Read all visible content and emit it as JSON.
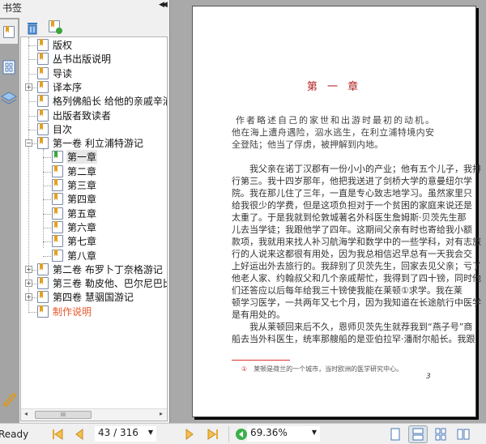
{
  "panel": {
    "title": "书签",
    "collapse_icon": "double-left-arrow"
  },
  "tree": [
    {
      "label": "版权",
      "level": 0
    },
    {
      "label": "丛书出版说明",
      "level": 0
    },
    {
      "label": "导读",
      "level": 0
    },
    {
      "label": "译本序",
      "level": 0,
      "expandable": true
    },
    {
      "label": "格列佛船长 给他的亲戚辛浦",
      "level": 0
    },
    {
      "label": "出版者致读者",
      "level": 0
    },
    {
      "label": "目次",
      "level": 0
    },
    {
      "label": "第一卷  利立浦特游记",
      "level": 0,
      "expanded": true
    },
    {
      "label": "第一章",
      "level": 1,
      "selected": true
    },
    {
      "label": "第二章",
      "level": 1
    },
    {
      "label": "第三章",
      "level": 1
    },
    {
      "label": "第四章",
      "level": 1
    },
    {
      "label": "第五章",
      "level": 1
    },
    {
      "label": "第六章",
      "level": 1
    },
    {
      "label": "第七章",
      "level": 1
    },
    {
      "label": "第八章",
      "level": 1
    },
    {
      "label": "第二卷  布罗卜丁奈格游记",
      "level": 0,
      "expandable": true
    },
    {
      "label": "第三卷  勒皮他、巴尔尼巴比",
      "level": 0,
      "expandable": true
    },
    {
      "label": "第四卷  慧骃国游记",
      "level": 0,
      "expandable": true
    },
    {
      "label": "制作说明",
      "level": 0,
      "color": "#e8572a"
    }
  ],
  "document": {
    "chapter_title": "第  一  章",
    "summary": [
      "作者略述自己的家世和出游时最初的动机。",
      "他在海上遭舟遇险，泅水逃生，在利立浦特境内安",
      "全登陆；他当了俘虏，被押解到内地。"
    ],
    "body": [
      "我父亲在诺丁汉郡有一份小小的产业；他有五个儿子，我排",
      "行第三。我十四岁那年，他把我送进了剑桥大学的意曼纽尔学",
      "院。我在那儿住了三年，一直是专心致志地学习。虽然家里只",
      "给我很少的学费，但是这项负担对于一个贫困的家庭来说还是",
      "太重了。于是我就到伦敦城著名外科医生詹姆斯·贝茨先生那",
      "儿去当学徒；我跟他学了四年。这期间父亲有时也寄给我小额",
      "款项，我就用来找人补习航海学和数学中的一些学科，对有志旅",
      "行的人说来这都很有用处，因为我总相信迟早总有一天我会交",
      "上好运出外去旅行的。我辞别了贝茨先生，回家去见父亲；亏了",
      "他老人家、约翰叔父和几个亲戚帮忙，我得到了四十镑，同时他",
      "们还答应以后每年给我三十镑使我能在莱顿①求学。我在莱",
      "顿学习医学，一共两年又七个月，因为我知道在长途航行中医学",
      "是有用处的。",
      "我从莱顿回来后不久，恩师贝茨先生就荐我到“燕子号”商",
      "船去当外科医生，统率那艘船的是亚伯拉罕·潘耐尔船长。我跟"
    ],
    "footnote_mark": "①",
    "footnote": "莱顿是荷兰的一个城市，当时欧洲的医学研究中心。",
    "page_number": "3"
  },
  "status": {
    "ready": "Ready",
    "page_field": "43 / 316",
    "zoom_field": "69.36%"
  },
  "colors": {
    "accent_red": "#b22222",
    "footnote_rule": "#e03030"
  }
}
